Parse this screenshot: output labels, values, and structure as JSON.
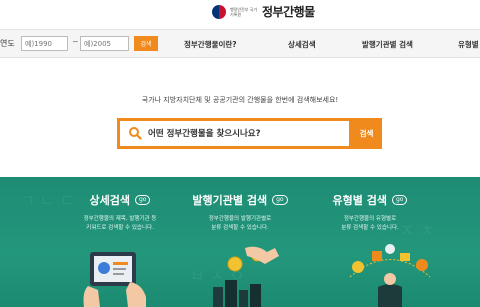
{
  "header": {
    "logo_subtitle": "행정안전부 국가기록원",
    "title": "정부간행물"
  },
  "topbar": {
    "year_label": "연도",
    "from_placeholder": "예)1990",
    "to_placeholder": "예)2005",
    "tilde": "~",
    "search_label": "검색",
    "nav": [
      "정부간행물이란?",
      "상세검색",
      "발행기관별 검색",
      "유형별"
    ]
  },
  "search": {
    "tagline": "국가나 지방자치단체 및 공공기관의 간행물을 한번에 검색해보세요!",
    "placeholder": "어떤 정부간행물을 찾으시나요?",
    "button_label": "검색"
  },
  "features": [
    {
      "title": "상세검색",
      "go": "go",
      "desc_1": "정부간행물의 제목, 발행기관 등",
      "desc_2": "키워드로 검색할 수 있습니다."
    },
    {
      "title": "발행기관별 검색",
      "go": "go",
      "desc_1": "정부간행물의 발행기관별로",
      "desc_2": "분류 검색할 수 있습니다."
    },
    {
      "title": "유형별 검색",
      "go": "go",
      "desc_1": "정부간행물의 유형별로",
      "desc_2": "분류 검색할 수 있습니다."
    }
  ],
  "colors": {
    "accent": "#f08a1c",
    "panel": "#1e8c74"
  }
}
